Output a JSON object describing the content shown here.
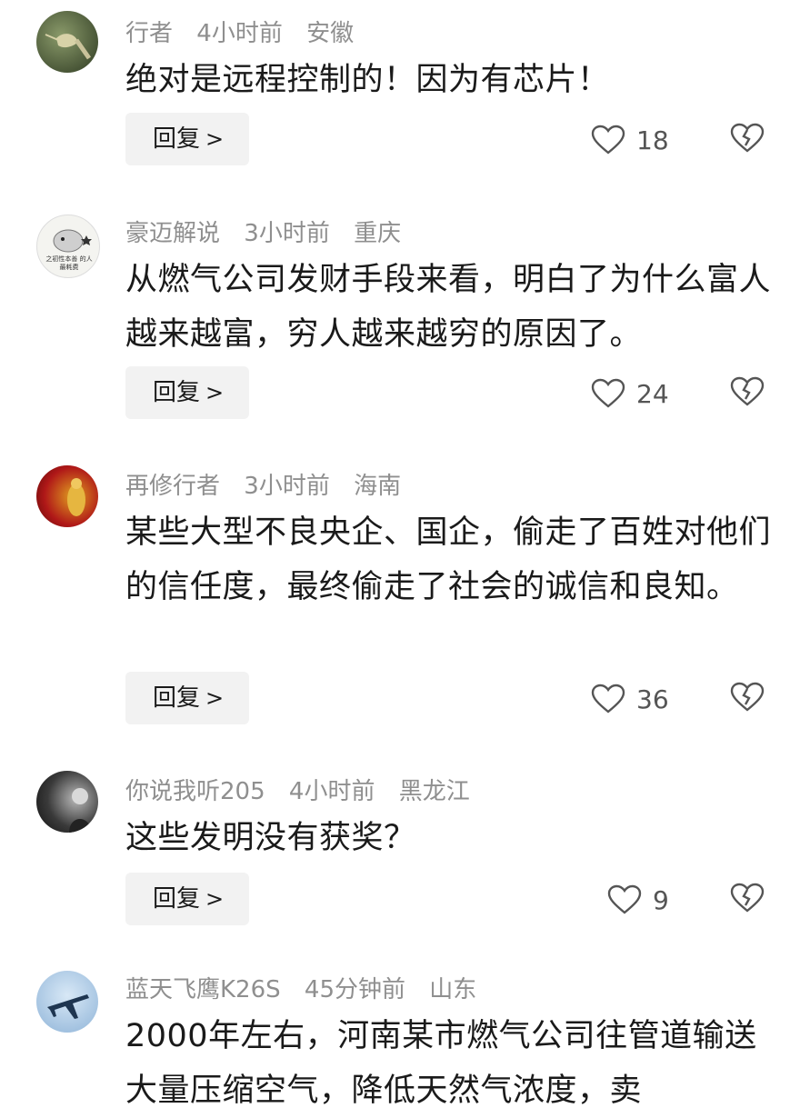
{
  "comments": [
    {
      "name": "行者",
      "time": "4小时前",
      "location": "安徽",
      "text": "绝对是远程控制的！因为有芯片！",
      "reply_label": "回复",
      "likes": "18"
    },
    {
      "name": "豪迈解说",
      "time": "3小时前",
      "location": "重庆",
      "text": "从燃气公司发财手段来看，明白了为什么富人越来越富，穷人越来越穷的原因了。",
      "reply_label": "回复",
      "likes": "24",
      "avatar_text": "之初性本善 的人最耗费"
    },
    {
      "name": "再修行者",
      "time": "3小时前",
      "location": "海南",
      "text": "某些大型不良央企、国企，偷走了百姓对他们的信任度，最终偷走了社会的诚信和良知。",
      "reply_label": "回复",
      "likes": "36"
    },
    {
      "name": "你说我听205",
      "time": "4小时前",
      "location": "黑龙江",
      "text": "这些发明没有获奖？",
      "reply_label": "回复",
      "likes": "9"
    },
    {
      "name": "蓝天飞鹰K26S",
      "time": "45分钟前",
      "location": "山东",
      "text": "2000年左右，河南某市燃气公司往管道输送大量压缩空气，降低天然气浓度，卖"
    }
  ]
}
